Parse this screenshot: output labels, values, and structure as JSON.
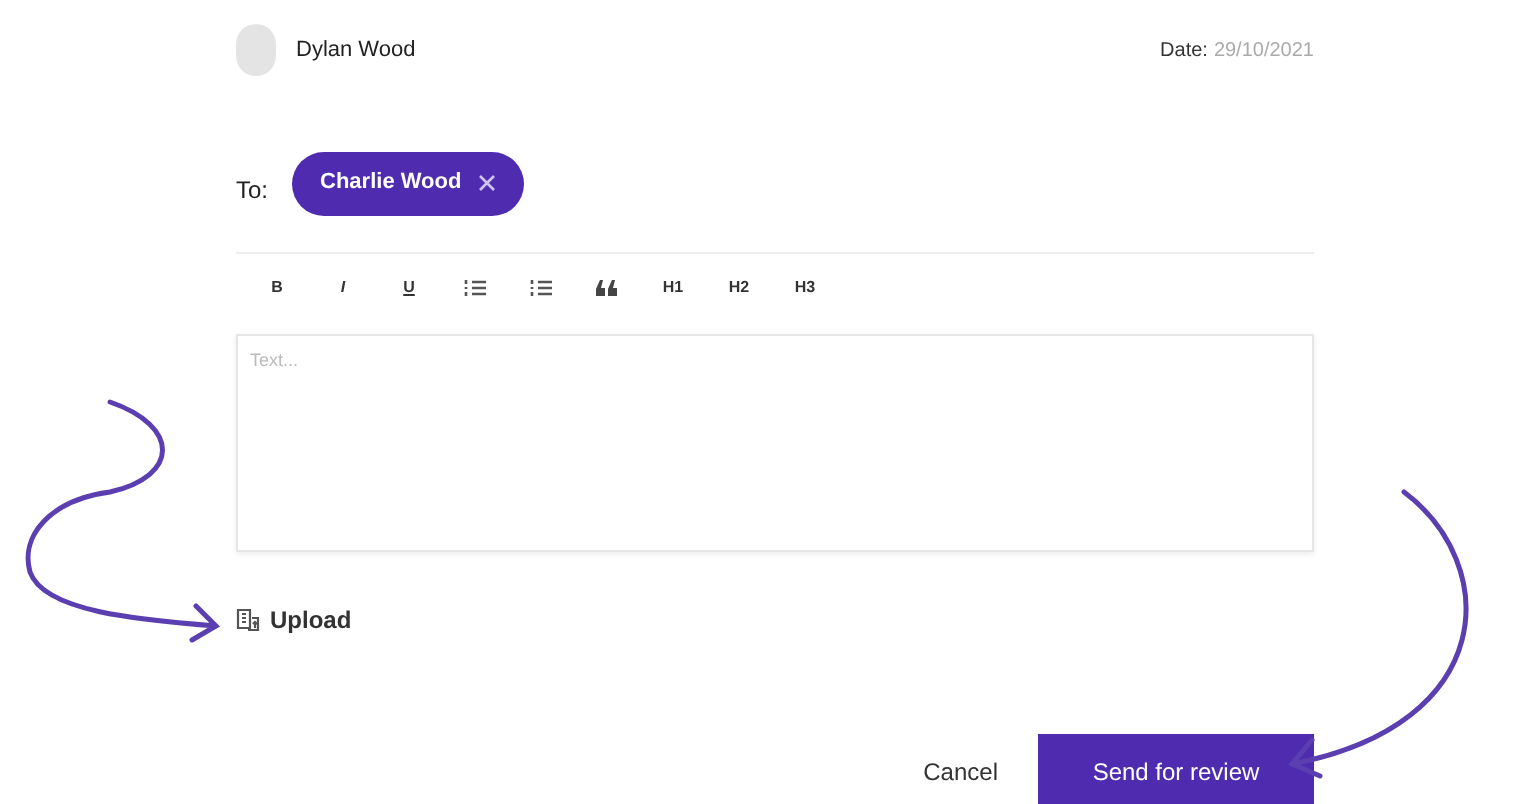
{
  "author": {
    "name": "Dylan Wood",
    "date_label": "Date:",
    "date": "29/10/2021"
  },
  "recipients": {
    "label": "To:",
    "chips": [
      "Charlie Wood"
    ]
  },
  "toolbar": [
    {
      "kind": "text",
      "label": "B"
    },
    {
      "kind": "text",
      "label": "I"
    },
    {
      "kind": "text",
      "label": "U"
    },
    {
      "kind": "bullets"
    },
    {
      "kind": "numbers"
    },
    {
      "kind": "quote"
    },
    {
      "kind": "text",
      "label": "H1"
    },
    {
      "kind": "text",
      "label": "H2"
    },
    {
      "kind": "text",
      "label": "H3"
    }
  ],
  "editor": {
    "placeholder": "Text..."
  },
  "upload": {
    "label": "Upload"
  },
  "buttons": {
    "cancel": "Cancel",
    "submit": "Send for review"
  }
}
